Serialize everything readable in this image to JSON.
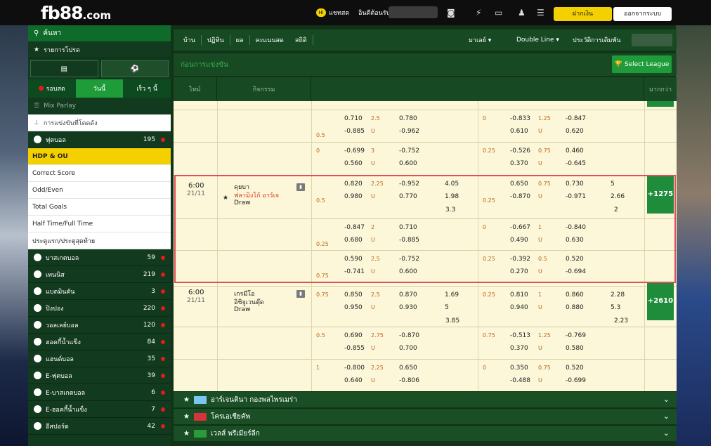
{
  "header": {
    "logo_main": "fb88",
    "logo_tld": ".com",
    "live_badge": "Hi",
    "live": "แชทสด",
    "user_greeting": "อินดีต้อนรับ,",
    "deposit": "ฝากเงิน",
    "logout": "ออกจากระบบ"
  },
  "sidebar": {
    "search": "ค้นหา",
    "favorites": "รายการโปรด",
    "tabs": [
      "รอบสด",
      "วันนี้",
      "เร็ว ๆ นี้"
    ],
    "mix_parlay": "Mix Parlay",
    "outright": "การแข่งขันที่โดดดัง",
    "football": {
      "label": "ฟุตบอล",
      "count": "195"
    },
    "sub": [
      "HDP & OU",
      "Correct Score",
      "Odd/Even",
      "Total Goals",
      "Half Time/Full Time",
      "ประตูแรก/ประตูสุดท้าย"
    ],
    "sports": [
      {
        "label": "บาสเกตบอล",
        "count": "59"
      },
      {
        "label": "เทนนิส",
        "count": "219"
      },
      {
        "label": "แบดมินตัน",
        "count": "3"
      },
      {
        "label": "ปิงปอง",
        "count": "220"
      },
      {
        "label": "วอลเลย์บอล",
        "count": "120"
      },
      {
        "label": "ฮอคกี้น้ำแข็ง",
        "count": "84"
      },
      {
        "label": "แฮนด์บอล",
        "count": "35"
      },
      {
        "label": "E-ฟุตบอล",
        "count": "39"
      },
      {
        "label": "E-บาสเกตบอล",
        "count": "6"
      },
      {
        "label": "E-ฮอคกี้น้ำแข็ง",
        "count": "7"
      },
      {
        "label": "อีสปอร์ต",
        "count": "42"
      }
    ]
  },
  "topnav": {
    "items": [
      "บ้าน",
      "ปฏิทิน",
      "ผล",
      "คะแนนสด",
      "สถิติ"
    ],
    "market": "มาเลย์",
    "line": "Double Line",
    "history": "ประวัติการเดิมพัน"
  },
  "subbar": {
    "title": "ก่อนการแข่งขัน",
    "select_league": "Select League"
  },
  "columns": {
    "time": "ไทม์",
    "event": "กิจกรรม",
    "more": "มากกว่า"
  },
  "match1": {
    "time": "6:00",
    "date": "21/11",
    "home": "คุยบา",
    "away": "ฟลามิงโก้ อาร์เจ",
    "draw": "Draw",
    "more": "+1275"
  },
  "match2": {
    "time": "6:00",
    "date": "21/11",
    "home": "เกรมีโอ",
    "away": "อิชิจูเวนตุ๊ด",
    "draw": "Draw",
    "more": "+2610"
  },
  "rows": [
    {
      "a": [
        "",
        "0.710",
        "2.5",
        "0.780",
        ""
      ],
      "b": [
        "0.5",
        "-0.885",
        "U",
        "-0.962",
        ""
      ],
      "c": [
        "0",
        "-0.833",
        "1.25",
        "-0.847",
        ""
      ],
      "d": [
        "",
        "0.610",
        "U",
        "0.620",
        ""
      ]
    },
    {
      "a": [
        "0",
        "-0.699",
        "3",
        "-0.752",
        ""
      ],
      "b": [
        "",
        "0.560",
        "U",
        "0.600",
        ""
      ],
      "c": [
        "0.25",
        "-0.526",
        "0.75",
        "0.460",
        ""
      ],
      "d": [
        "",
        "0.370",
        "U",
        "-0.645",
        ""
      ]
    },
    {
      "a": [
        "",
        "0.820",
        "2.25",
        "-0.952",
        "4.05"
      ],
      "b": [
        "0.5",
        "0.980",
        "U",
        "0.770",
        "1.98"
      ],
      "x": "3.3",
      "c": [
        "",
        "0.650",
        "0.75",
        "0.730",
        "5"
      ],
      "d": [
        "0.25",
        "-0.870",
        "U",
        "-0.971",
        "2.66"
      ],
      "y": "2"
    },
    {
      "a": [
        "",
        "-0.847",
        "2",
        "0.710",
        ""
      ],
      "b": [
        "0.25",
        "0.680",
        "U",
        "-0.885",
        ""
      ],
      "c": [
        "0",
        "-0.667",
        "1",
        "-0.840",
        ""
      ],
      "d": [
        "",
        "0.490",
        "U",
        "0.630",
        ""
      ]
    },
    {
      "a": [
        "",
        "0.590",
        "2.5",
        "-0.752",
        ""
      ],
      "b": [
        "0.75",
        "-0.741",
        "U",
        "0.600",
        ""
      ],
      "c": [
        "0.25",
        "-0.392",
        "0.5",
        "0.520",
        ""
      ],
      "d": [
        "",
        "0.270",
        "U",
        "-0.694",
        ""
      ]
    },
    {
      "a": [
        "0.75",
        "0.850",
        "2.5",
        "0.870",
        "1.69"
      ],
      "b": [
        "",
        "0.950",
        "U",
        "0.930",
        "5"
      ],
      "x": "3.85",
      "c": [
        "0.25",
        "0.810",
        "1",
        "0.860",
        "2.28"
      ],
      "d": [
        "",
        "0.940",
        "U",
        "0.880",
        "5.3"
      ],
      "y": "2.23"
    },
    {
      "a": [
        "0.5",
        "0.690",
        "2.75",
        "-0.870",
        ""
      ],
      "b": [
        "",
        "-0.855",
        "U",
        "0.700",
        ""
      ],
      "c": [
        "0.75",
        "-0.513",
        "1.25",
        "-0.769",
        ""
      ],
      "d": [
        "",
        "0.370",
        "U",
        "0.580",
        ""
      ]
    },
    {
      "a": [
        "1",
        "-0.800",
        "2.25",
        "0.650",
        ""
      ],
      "b": [
        "",
        "0.640",
        "U",
        "-0.806",
        ""
      ],
      "c": [
        "0",
        "0.350",
        "0.75",
        "0.520",
        ""
      ],
      "d": [
        "",
        "-0.488",
        "U",
        "-0.699",
        ""
      ]
    }
  ],
  "leagues": [
    {
      "name": "อาร์เจนตินา กองพลไพรเมร่า",
      "flag": "#7ac6f0"
    },
    {
      "name": "โครเอเชียคัพ",
      "flag": "#d6333a"
    },
    {
      "name": "เวลส์ พรีเมียร์ลีก",
      "flag": "#2a9a3a"
    }
  ]
}
